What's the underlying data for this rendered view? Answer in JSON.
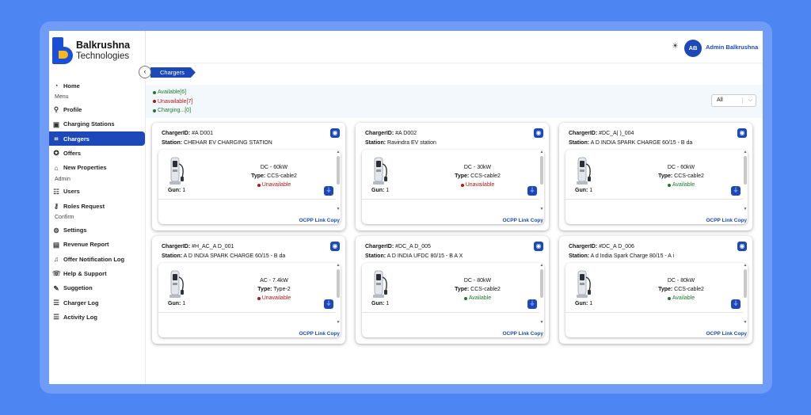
{
  "brand": {
    "name": "Balkrushna",
    "sub": "Technologies"
  },
  "header": {
    "avatar_initials": "AB",
    "user_name": "Admin Balkrushna",
    "theme_icon": "sun-icon"
  },
  "breadcrumb": "Chargers",
  "sidebar": {
    "items": [
      {
        "label": "Home",
        "icon": "home-icon"
      },
      {
        "section": "Menu"
      },
      {
        "label": "Profile",
        "icon": "user-icon"
      },
      {
        "label": "Charging Stations",
        "icon": "station-icon"
      },
      {
        "label": "Chargers",
        "icon": "charger-icon",
        "active": true
      },
      {
        "label": "Offers",
        "icon": "offer-icon"
      },
      {
        "label": "New Properties",
        "icon": "bank-icon"
      },
      {
        "section": "Admin"
      },
      {
        "label": "Users",
        "icon": "users-icon"
      },
      {
        "label": "Roles Request",
        "icon": "roles-icon"
      },
      {
        "section": "Confirm"
      },
      {
        "label": "Settings",
        "icon": "settings-icon"
      },
      {
        "label": "Revenue Report",
        "icon": "report-icon"
      },
      {
        "label": "Offer Notification Log",
        "icon": "bell-icon"
      },
      {
        "label": "Help & Support",
        "icon": "help-icon"
      },
      {
        "label": "Suggetion",
        "icon": "suggestion-icon"
      },
      {
        "label": "Charger Log",
        "icon": "list-icon"
      },
      {
        "label": "Activity Log",
        "icon": "list-icon"
      }
    ]
  },
  "status_summary": {
    "available": "Available[6]",
    "unavailable": "Unavailable[7]",
    "charging": "Charging...[0]"
  },
  "filter": {
    "selected": "All"
  },
  "colors": {
    "accent": "#1d49b8",
    "available": "#1c7a2c",
    "unavailable": "#b01818",
    "background": "#4d86f3"
  },
  "cards": [
    {
      "charger_id": "#A       D001",
      "station": "CHEHAR EV CHARGING STATION",
      "power": "DC - 60kW",
      "type": "CCS-cable2",
      "status": "Unavailable",
      "gun": "1",
      "ocpp": "OCPP Link Copy"
    },
    {
      "charger_id": "#A       D002",
      "station": "Ravindra EV station",
      "power": "DC - 30kW",
      "type": "CCS-cable2",
      "status": "Unavailable",
      "gun": "1",
      "ocpp": "OCPP Link Copy"
    },
    {
      "charger_id": "#DC_A|        )_004",
      "station": "A       D INDIA SPARK CHARGE 60/15 - B          da",
      "power": "DC - 60kW",
      "type": "CCS-cable2",
      "status": "Available",
      "gun": "1",
      "ocpp": "OCPP Link Copy"
    },
    {
      "charger_id": "#H_AC_A       D_001",
      "station": "A        D INDIA SPARK CHARGE 60/15 - B          da",
      "power": "AC - 7.4kW",
      "type": "Type-2",
      "status": "Unavailable",
      "gun": "1",
      "ocpp": "OCPP Link Copy"
    },
    {
      "charger_id": "#DC_A        D_005",
      "station": "A        D INDIA UFDC 80/15 - B      A X",
      "power": "DC - 80kW",
      "type": "CCS-cable2",
      "status": "Available",
      "gun": "1",
      "ocpp": "OCPP Link Copy"
    },
    {
      "charger_id": "#DC_A        D_006",
      "station": "A     d India Spark Charge 80/15 - A     i",
      "power": "DC - 80kW",
      "type": "CCS-cable2",
      "status": "Available",
      "gun": "1",
      "ocpp": "OCPP Link Copy"
    }
  ],
  "labels": {
    "charger_id": "ChargerID:",
    "station": "Station:",
    "type": "Type:",
    "gun": "Gun:"
  }
}
